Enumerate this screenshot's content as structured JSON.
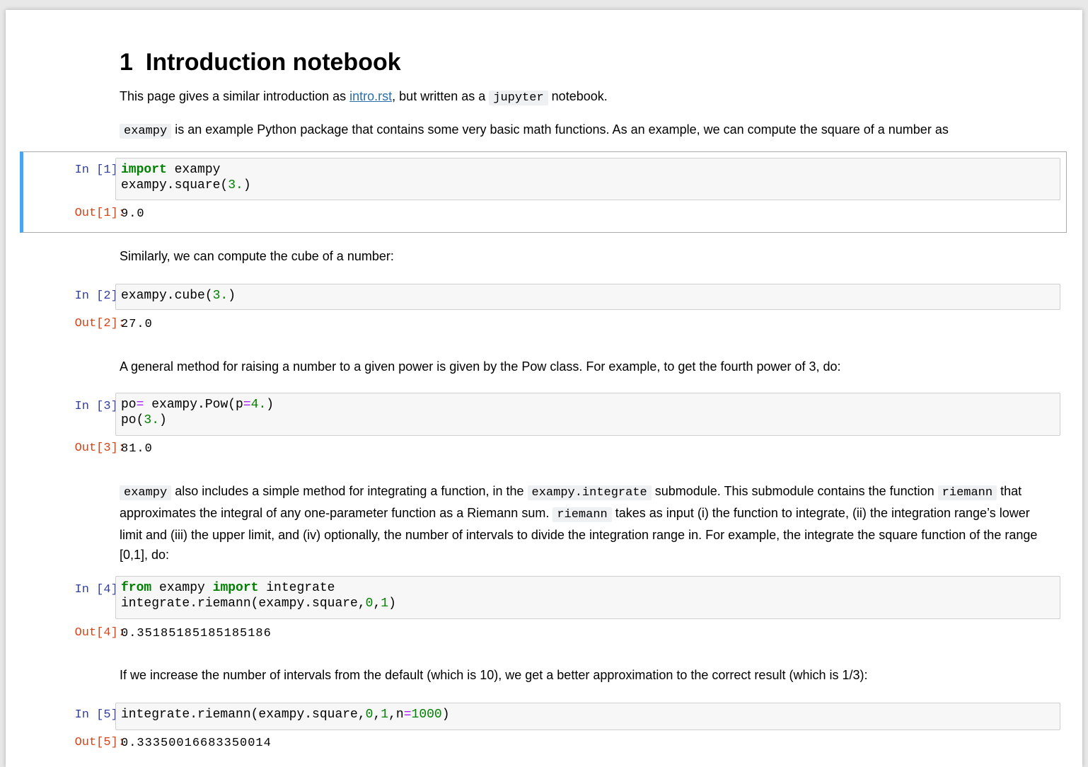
{
  "header": {
    "section_number": "1",
    "title": "Introduction notebook"
  },
  "intro": {
    "p1_before": "This page gives a similar introduction as ",
    "p1_link": "intro.rst",
    "p1_middle": ", but written as a ",
    "p1_code": "jupyter",
    "p1_after": " notebook.",
    "p2_code": "exampy",
    "p2_text": " is an example Python package that contains some very basic math functions. As an example, we can compute the square of a number as"
  },
  "cells": {
    "c1": {
      "in_prompt": "In [1]:",
      "out_prompt": "Out[1]:",
      "line1_kw": "import",
      "line1_rest": " exampy",
      "line2_a": "exampy.square(",
      "line2_num": "3.",
      "line2_b": ")",
      "output": "9.0"
    },
    "c2": {
      "in_prompt": "In [2]:",
      "out_prompt": "Out[2]:",
      "line1_a": "exampy.cube(",
      "line1_num": "3.",
      "line1_b": ")",
      "output": "27.0"
    },
    "c3": {
      "in_prompt": "In [3]:",
      "out_prompt": "Out[3]:",
      "line1_a": "po",
      "line1_op": "=",
      "line1_b": " exampy.Pow(p",
      "line1_op2": "=",
      "line1_num": "4.",
      "line1_c": ")",
      "line2_a": "po(",
      "line2_num": "3.",
      "line2_b": ")",
      "output": "81.0"
    },
    "c4": {
      "in_prompt": "In [4]:",
      "out_prompt": "Out[4]:",
      "line1_kw1": "from",
      "line1_mid": " exampy ",
      "line1_kw2": "import",
      "line1_rest": " integrate",
      "line2_a": "integrate.riemann(exampy.square,",
      "line2_n0": "0",
      "line2_comma": ",",
      "line2_n1": "1",
      "line2_b": ")",
      "output": "0.35185185185185186"
    },
    "c5": {
      "in_prompt": "In [5]:",
      "out_prompt": "Out[5]:",
      "line1_a": "integrate.riemann(exampy.square,",
      "line1_n0": "0",
      "line1_c1": ",",
      "line1_n1": "1",
      "line1_c2": ",n",
      "line1_op": "=",
      "line1_n2": "1000",
      "line1_b": ")",
      "output": "0.33350016683350014"
    }
  },
  "text": {
    "similarly": "Similarly, we can compute the cube of a number:",
    "general": "A general method for raising a number to a given power is given by the Pow class. For example, to get the fourth power of 3, do:",
    "integ_code1": "exampy",
    "integ_t1": " also includes a simple method for integrating a function, in the ",
    "integ_code2": "exampy.integrate",
    "integ_t2": " submodule. This submodule contains the function ",
    "integ_code3": "riemann",
    "integ_t3": " that approximates the integral of any one-parameter function as a Riemann sum. ",
    "integ_code4": "riemann",
    "integ_t4": " takes as input (i) the function to integrate, (ii) the integration range’s lower limit and (iii) the upper limit, and (iv) optionally, the number of intervals to divide the integration range in. For example, the integrate the square function of the range [0,1], do:",
    "increase": "If we increase the number of intervals from the default (which is 10), we get a better approximation to the correct result (which is 1/3):"
  }
}
